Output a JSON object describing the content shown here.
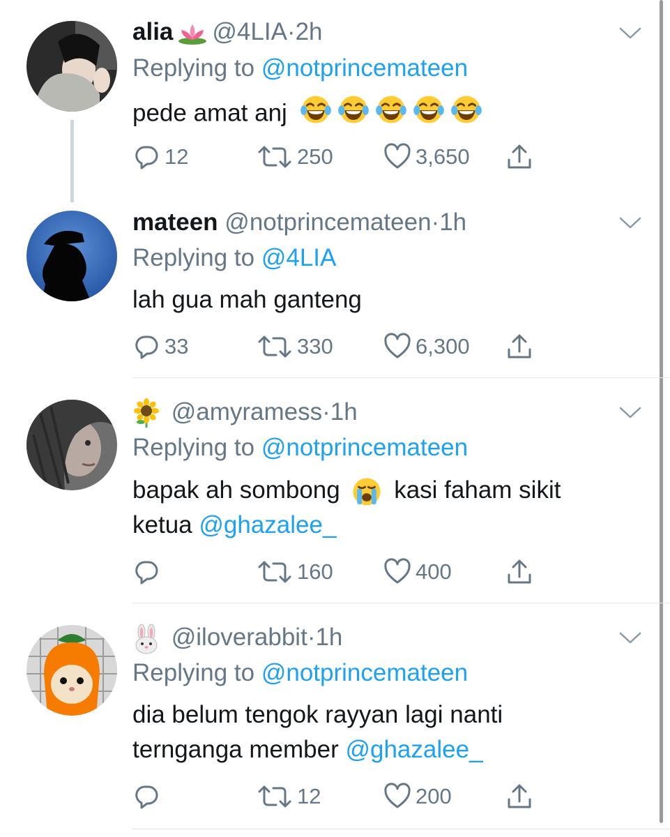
{
  "tweets": [
    {
      "name": "alia",
      "name_emoji": "lotus",
      "handle": "@4LIA",
      "time": "2h",
      "replying_prefix": "Replying to",
      "replying_to": "@notprincemateen",
      "text": "pede amat anj",
      "text_emoji": "face-with-tears-of-joy x5",
      "replies": "12",
      "retweets": "250",
      "likes": "3,650"
    },
    {
      "name": "mateen",
      "handle": "@notprincemateen",
      "time": "1h",
      "replying_prefix": "Replying to",
      "replying_to": "@4LIA",
      "text": "lah gua mah ganteng",
      "replies": "33",
      "retweets": "330",
      "likes": "6,300"
    },
    {
      "name_emoji": "sunflower",
      "handle": "@amyramess",
      "time": "1h",
      "replying_prefix": "Replying to",
      "replying_to": "@notprincemateen",
      "text_part1": "bapak ah sombong",
      "text_emoji": "loudly-crying-face",
      "text_part2": "kasi faham sikit",
      "text_part3": "ketua",
      "text_mention": "@ghazalee_",
      "replies": "",
      "retweets": "160",
      "likes": "400"
    },
    {
      "name_emoji": "rabbit-face",
      "handle": "@iloverabbit",
      "time": "1h",
      "replying_prefix": "Replying to",
      "replying_to": "@notprincemateen",
      "text_line1": "dia belum tengok rayyan lagi nanti",
      "text_line2": "ternganga member",
      "text_mention": "@ghazalee_",
      "replies": "",
      "retweets": "12",
      "likes": "200"
    }
  ],
  "separator": "·",
  "colors": {
    "accent": "#1da1f2",
    "secondary_text": "#657786",
    "primary_text": "#14171a",
    "divider": "#e1e8ed",
    "thread_line": "#ccd6dd"
  },
  "icons": [
    "reply-icon",
    "retweet-icon",
    "like-icon",
    "share-icon",
    "chevron-down-icon"
  ]
}
